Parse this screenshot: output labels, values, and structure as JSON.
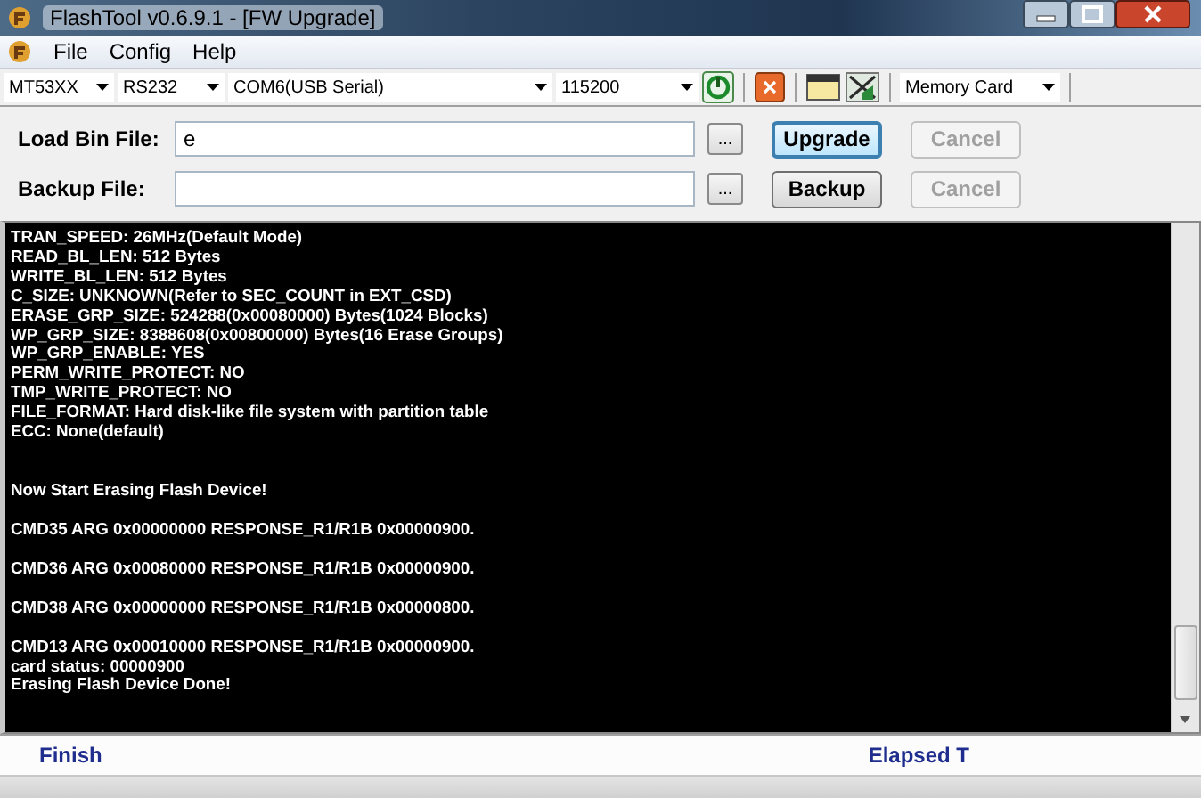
{
  "window": {
    "title": "FlashTool v0.6.9.1 - [FW Upgrade]"
  },
  "menu": [
    {
      "label": "File"
    },
    {
      "label": "Config"
    },
    {
      "label": "Help"
    }
  ],
  "toolbar": {
    "selects": [
      {
        "value": "MT53XX"
      },
      {
        "value": "RS232"
      },
      {
        "value": "COM6(USB Serial)"
      },
      {
        "value": "115200"
      }
    ],
    "storage": {
      "value": "Memory Card"
    }
  },
  "load_row": {
    "label": "Load Bin File:",
    "value": "e",
    "browse": "...",
    "action": {
      "label": "Upgrade",
      "disabled": false,
      "focused": true
    },
    "cancel": {
      "label": "Cancel",
      "disabled": true
    }
  },
  "backup_row": {
    "label": "Backup File:",
    "browse": "...",
    "action": {
      "label": "Backup",
      "disabled": false,
      "focused": false
    },
    "cancel": {
      "label": "Cancel",
      "disabled": true
    }
  },
  "log": [
    {
      "lines": [
        "TRAN_SPEED: 26MHz(Default Mode)",
        "READ_BL_LEN: 512 Bytes",
        "WRITE_BL_LEN: 512 Bytes",
        "C_SIZE: UNKNOWN(Refer to SEC_COUNT in EXT_CSD)",
        "ERASE_GRP_SIZE: 524288(0x00080000) Bytes(1024 Blocks)",
        "WP_GRP_SIZE: 8388608(0x00800000) Bytes(16 Erase Groups)",
        "WP_GRP_ENABLE: YES",
        "PERM_WRITE_PROTECT: NO",
        "TMP_WRITE_PROTECT: NO",
        "FILE_FORMAT: Hard disk-like file system with partition table",
        "ECC: None(default)"
      ]
    },
    {
      "lines": [
        "Now Start Erasing Flash Device!"
      ]
    },
    {
      "lines": [
        "CMD35 ARG 0x00000000 RESPONSE_R1/R1B 0x00000900."
      ]
    },
    {
      "lines": [
        "CMD36 ARG 0x00080000 RESPONSE_R1/R1B 0x00000900."
      ]
    },
    {
      "lines": [
        "CMD38 ARG 0x00000000 RESPONSE_R1/R1B 0x00000800."
      ]
    },
    {
      "lines": [
        "CMD13 ARG 0x00010000 RESPONSE_R1/R1B 0x00000900.",
        "card status: 00000900",
        "Erasing Flash Device Done!"
      ]
    }
  ],
  "status_bar": {
    "status": "Finish",
    "elapsed": "Elapsed T"
  }
}
